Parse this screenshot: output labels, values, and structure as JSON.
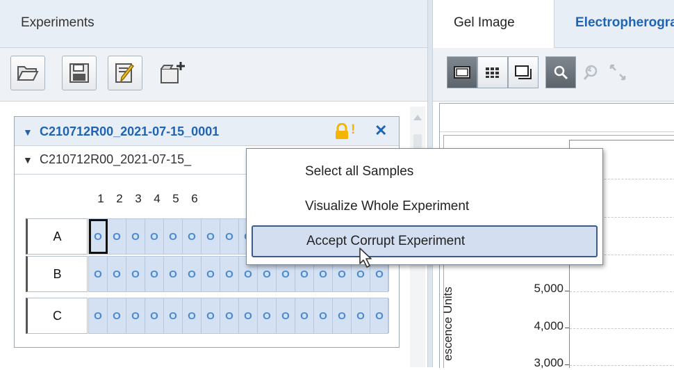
{
  "left_panel": {
    "title": "Experiments",
    "toolbar": {
      "open_icon": "folder-open-icon",
      "save_icon": "save-icon",
      "edit_icon": "edit-pencil-icon",
      "new_icon": "new-document-icon"
    },
    "experiment": {
      "title": "C210712R00_2021-07-15_0001",
      "sub_title": "C210712R00_2021-07-15_",
      "columns": [
        "1",
        "2",
        "3",
        "4",
        "5",
        "6"
      ],
      "rows": [
        {
          "label": "A"
        },
        {
          "label": "B"
        },
        {
          "label": "C"
        }
      ],
      "well_glyph": "O",
      "lock_warning": "!",
      "close_glyph": "✕"
    }
  },
  "right_panel": {
    "tabs": [
      {
        "label": "Gel Image"
      },
      {
        "label": "Electropherogram"
      }
    ],
    "chart": {
      "y_axis_label": "escence Units",
      "ticks": [
        "5,000",
        "4,000",
        "3,000"
      ]
    }
  },
  "context_menu": {
    "items": [
      {
        "label": "Select all Samples"
      },
      {
        "label": "Visualize Whole Experiment"
      },
      {
        "label": "Accept Corrupt Experiment"
      }
    ]
  },
  "colors": {
    "accent": "#1f64b3",
    "panel_bg": "#e8eef5",
    "well_bg": "#d4e1f3",
    "lock": "#f4b400"
  }
}
